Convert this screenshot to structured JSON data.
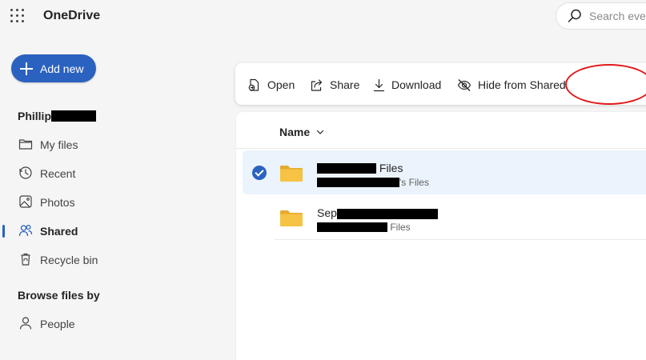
{
  "app": {
    "title": "OneDrive"
  },
  "search": {
    "placeholder": "Search everything"
  },
  "sidebar": {
    "add_new_label": "Add new",
    "user_name": "Phillip",
    "items": [
      {
        "label": "My files",
        "icon": "folder-icon"
      },
      {
        "label": "Recent",
        "icon": "clock-icon"
      },
      {
        "label": "Photos",
        "icon": "photo-icon"
      },
      {
        "label": "Shared",
        "icon": "people-icon",
        "active": true
      },
      {
        "label": "Recycle bin",
        "icon": "trash-icon"
      }
    ],
    "browse_title": "Browse files by",
    "browse_items": [
      {
        "label": "People",
        "icon": "person-icon"
      }
    ]
  },
  "toolbar": {
    "open_label": "Open",
    "share_label": "Share",
    "download_label": "Download",
    "hide_label": "Hide from Shared"
  },
  "list": {
    "column_name": "Name",
    "rows": [
      {
        "name": "Files",
        "subtitle": "'s Files",
        "selected": true
      },
      {
        "name": "Sep",
        "subtitle": "Files",
        "selected": false
      }
    ]
  },
  "colors": {
    "accent": "#2b62c0",
    "folder": "#f6c344",
    "selection": "#ebf3fc",
    "annotation": "#e0191b"
  }
}
